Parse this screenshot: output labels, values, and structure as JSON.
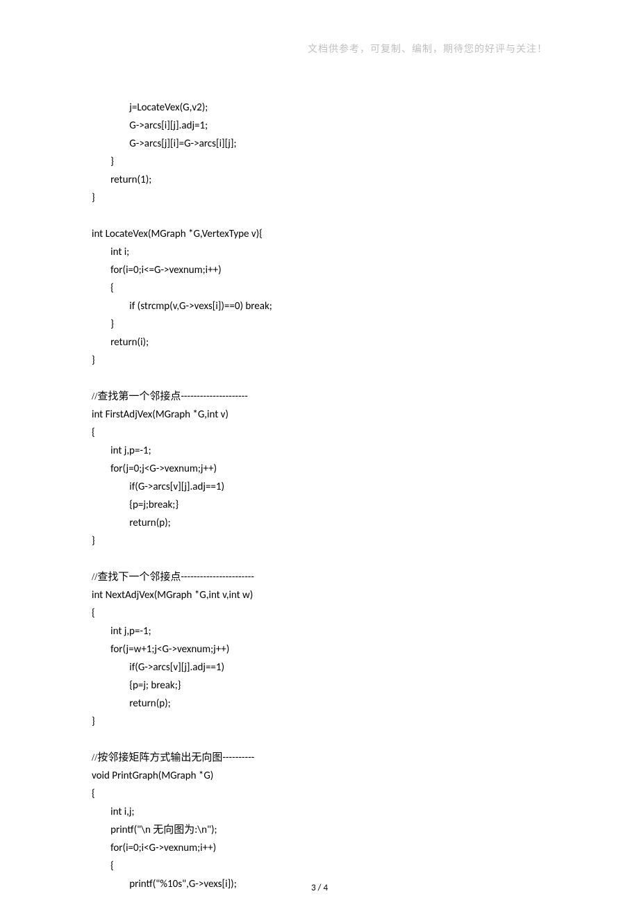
{
  "header": {
    "note": "文档供参考，可复制、编制，期待您的好评与关注！"
  },
  "footer": {
    "label": "3  /  4"
  },
  "code": {
    "l1": "                j=LocateVex(G,v2);",
    "l2": "                G->arcs[i][j].adj=1;",
    "l3": "                G->arcs[j][i]=G->arcs[i][j];",
    "l4": "        }",
    "l5": "        return(1);",
    "l6": "}",
    "l7": "",
    "l8": "int LocateVex(MGraph *G,VertexType v){",
    "l9": "        int i;",
    "l10": "        for(i=0;i<=G->vexnum;i++)",
    "l11": "        {",
    "l12": "                if (strcmp(v,G->vexs[i])==0) break;",
    "l13": "        }",
    "l14": "        return(i);",
    "l15": "}",
    "l16": "",
    "c17a": "//查找第一个邻接点",
    "c17b": "---------------------",
    "l18": "int FirstAdjVex(MGraph *G,int v)",
    "l19": "{",
    "l20": "        int j,p=-1;",
    "l21": "        for(j=0;j<G->vexnum;j++)",
    "l22": "                if(G->arcs[v][j].adj==1)",
    "l23": "                {p=j;break;}",
    "l24": "                return(p);",
    "l25": "}",
    "l26": "",
    "c27a": "//查找下一个邻接点",
    "c27b": "-----------------------",
    "l28": "int NextAdjVex(MGraph *G,int v,int w)",
    "l29": "{",
    "l30": "        int j,p=-1;",
    "l31": "        for(j=w+1;j<G->vexnum;j++)",
    "l32": "                if(G->arcs[v][j].adj==1)",
    "l33": "                {p=j; break;}",
    "l34": "                return(p);",
    "l35": "}",
    "l36": "",
    "c37a": "//按邻接矩阵方式输出无向图",
    "c37b": "----------",
    "l38": "void PrintGraph(MGraph *G)",
    "l39": "{",
    "l40": "        int i,j;",
    "c41a": "        printf(\"\\n ",
    "c41b": "无向图为",
    "c41c": ":\\n\");",
    "l42": "        for(i=0;i<G->vexnum;i++)",
    "l43": "        {",
    "l44": "                printf(\"%10s\",G->vexs[i]);"
  }
}
